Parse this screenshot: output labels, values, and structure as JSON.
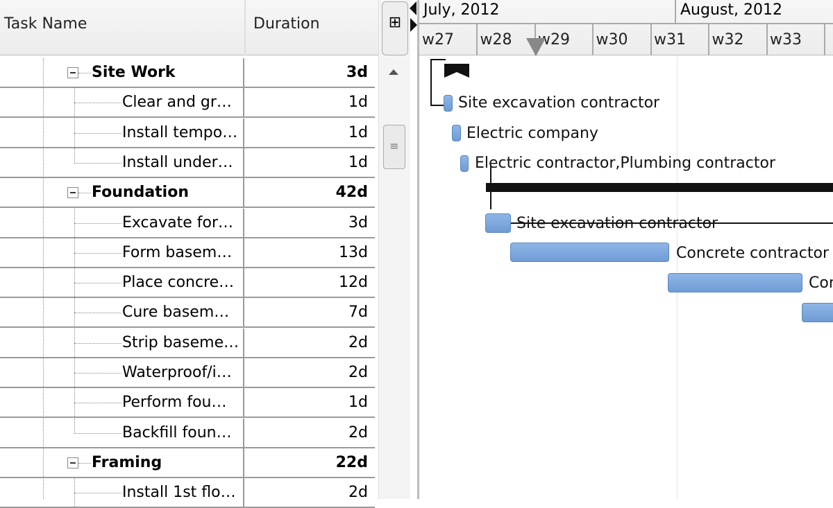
{
  "columns": {
    "task_name": "Task Name",
    "duration": "Duration"
  },
  "rows": [
    {
      "name": "Site Work",
      "duration": "3d",
      "summary": true
    },
    {
      "name": "Clear and gr…",
      "duration": "1d"
    },
    {
      "name": "Install tempo…",
      "duration": "1d"
    },
    {
      "name": "Install under…",
      "duration": "1d"
    },
    {
      "name": "Foundation",
      "duration": "42d",
      "summary": true
    },
    {
      "name": "Excavate for…",
      "duration": "3d"
    },
    {
      "name": "Form basem…",
      "duration": "13d"
    },
    {
      "name": "Place concre…",
      "duration": "12d"
    },
    {
      "name": "Cure basem…",
      "duration": "7d"
    },
    {
      "name": "Strip baseme…",
      "duration": "2d"
    },
    {
      "name": "Waterproof/i…",
      "duration": "2d"
    },
    {
      "name": "Perform fou…",
      "duration": "1d"
    },
    {
      "name": "Backfill foun…",
      "duration": "2d"
    },
    {
      "name": "Framing",
      "duration": "22d",
      "summary": true
    },
    {
      "name": "Install 1st flo…",
      "duration": "2d"
    }
  ],
  "timeline": {
    "months": [
      "July, 2012",
      "August, 2012"
    ],
    "weeks": [
      "w27",
      "w28",
      "w29",
      "w30",
      "w31",
      "w32",
      "w33"
    ]
  },
  "gantt_labels": [
    "Site excavation contractor",
    "Electric company",
    "Electric contractor,Plumbing contractor",
    "Site excavation contractor",
    "Concrete contractor",
    "Concrete contractor"
  ]
}
